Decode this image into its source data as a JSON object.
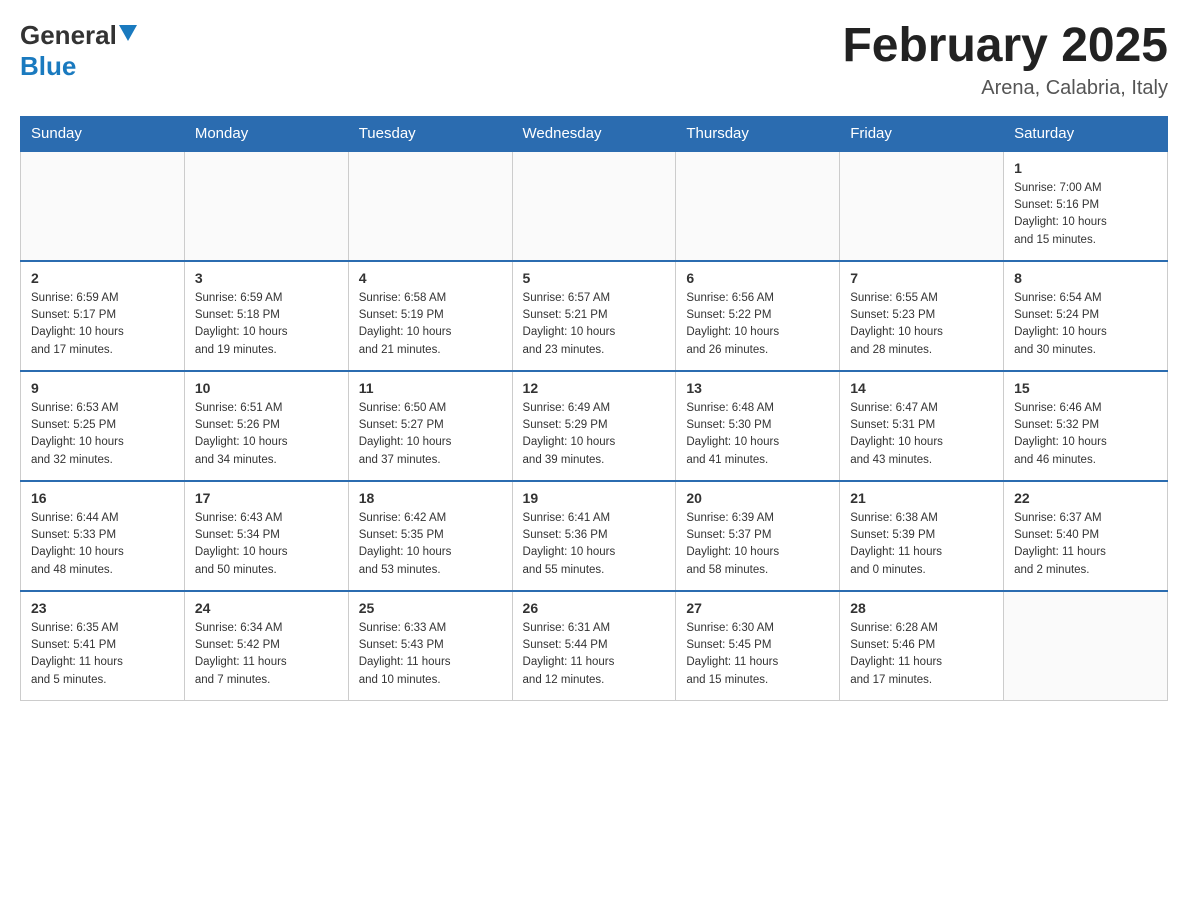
{
  "header": {
    "logo_line1": "General",
    "logo_arrow": "▼",
    "logo_line2": "Blue",
    "month_title": "February 2025",
    "location": "Arena, Calabria, Italy"
  },
  "days_of_week": [
    "Sunday",
    "Monday",
    "Tuesday",
    "Wednesday",
    "Thursday",
    "Friday",
    "Saturday"
  ],
  "weeks": [
    {
      "days": [
        {
          "num": "",
          "info": ""
        },
        {
          "num": "",
          "info": ""
        },
        {
          "num": "",
          "info": ""
        },
        {
          "num": "",
          "info": ""
        },
        {
          "num": "",
          "info": ""
        },
        {
          "num": "",
          "info": ""
        },
        {
          "num": "1",
          "info": "Sunrise: 7:00 AM\nSunset: 5:16 PM\nDaylight: 10 hours\nand 15 minutes."
        }
      ]
    },
    {
      "days": [
        {
          "num": "2",
          "info": "Sunrise: 6:59 AM\nSunset: 5:17 PM\nDaylight: 10 hours\nand 17 minutes."
        },
        {
          "num": "3",
          "info": "Sunrise: 6:59 AM\nSunset: 5:18 PM\nDaylight: 10 hours\nand 19 minutes."
        },
        {
          "num": "4",
          "info": "Sunrise: 6:58 AM\nSunset: 5:19 PM\nDaylight: 10 hours\nand 21 minutes."
        },
        {
          "num": "5",
          "info": "Sunrise: 6:57 AM\nSunset: 5:21 PM\nDaylight: 10 hours\nand 23 minutes."
        },
        {
          "num": "6",
          "info": "Sunrise: 6:56 AM\nSunset: 5:22 PM\nDaylight: 10 hours\nand 26 minutes."
        },
        {
          "num": "7",
          "info": "Sunrise: 6:55 AM\nSunset: 5:23 PM\nDaylight: 10 hours\nand 28 minutes."
        },
        {
          "num": "8",
          "info": "Sunrise: 6:54 AM\nSunset: 5:24 PM\nDaylight: 10 hours\nand 30 minutes."
        }
      ]
    },
    {
      "days": [
        {
          "num": "9",
          "info": "Sunrise: 6:53 AM\nSunset: 5:25 PM\nDaylight: 10 hours\nand 32 minutes."
        },
        {
          "num": "10",
          "info": "Sunrise: 6:51 AM\nSunset: 5:26 PM\nDaylight: 10 hours\nand 34 minutes."
        },
        {
          "num": "11",
          "info": "Sunrise: 6:50 AM\nSunset: 5:27 PM\nDaylight: 10 hours\nand 37 minutes."
        },
        {
          "num": "12",
          "info": "Sunrise: 6:49 AM\nSunset: 5:29 PM\nDaylight: 10 hours\nand 39 minutes."
        },
        {
          "num": "13",
          "info": "Sunrise: 6:48 AM\nSunset: 5:30 PM\nDaylight: 10 hours\nand 41 minutes."
        },
        {
          "num": "14",
          "info": "Sunrise: 6:47 AM\nSunset: 5:31 PM\nDaylight: 10 hours\nand 43 minutes."
        },
        {
          "num": "15",
          "info": "Sunrise: 6:46 AM\nSunset: 5:32 PM\nDaylight: 10 hours\nand 46 minutes."
        }
      ]
    },
    {
      "days": [
        {
          "num": "16",
          "info": "Sunrise: 6:44 AM\nSunset: 5:33 PM\nDaylight: 10 hours\nand 48 minutes."
        },
        {
          "num": "17",
          "info": "Sunrise: 6:43 AM\nSunset: 5:34 PM\nDaylight: 10 hours\nand 50 minutes."
        },
        {
          "num": "18",
          "info": "Sunrise: 6:42 AM\nSunset: 5:35 PM\nDaylight: 10 hours\nand 53 minutes."
        },
        {
          "num": "19",
          "info": "Sunrise: 6:41 AM\nSunset: 5:36 PM\nDaylight: 10 hours\nand 55 minutes."
        },
        {
          "num": "20",
          "info": "Sunrise: 6:39 AM\nSunset: 5:37 PM\nDaylight: 10 hours\nand 58 minutes."
        },
        {
          "num": "21",
          "info": "Sunrise: 6:38 AM\nSunset: 5:39 PM\nDaylight: 11 hours\nand 0 minutes."
        },
        {
          "num": "22",
          "info": "Sunrise: 6:37 AM\nSunset: 5:40 PM\nDaylight: 11 hours\nand 2 minutes."
        }
      ]
    },
    {
      "days": [
        {
          "num": "23",
          "info": "Sunrise: 6:35 AM\nSunset: 5:41 PM\nDaylight: 11 hours\nand 5 minutes."
        },
        {
          "num": "24",
          "info": "Sunrise: 6:34 AM\nSunset: 5:42 PM\nDaylight: 11 hours\nand 7 minutes."
        },
        {
          "num": "25",
          "info": "Sunrise: 6:33 AM\nSunset: 5:43 PM\nDaylight: 11 hours\nand 10 minutes."
        },
        {
          "num": "26",
          "info": "Sunrise: 6:31 AM\nSunset: 5:44 PM\nDaylight: 11 hours\nand 12 minutes."
        },
        {
          "num": "27",
          "info": "Sunrise: 6:30 AM\nSunset: 5:45 PM\nDaylight: 11 hours\nand 15 minutes."
        },
        {
          "num": "28",
          "info": "Sunrise: 6:28 AM\nSunset: 5:46 PM\nDaylight: 11 hours\nand 17 minutes."
        },
        {
          "num": "",
          "info": ""
        }
      ]
    }
  ]
}
